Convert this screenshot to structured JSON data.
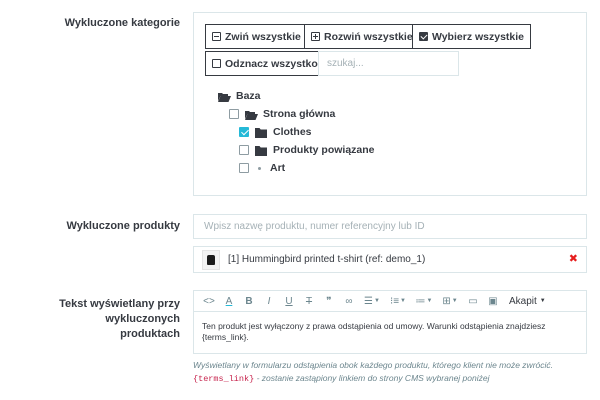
{
  "excluded_categories": {
    "label": "Wykluczone kategorie",
    "buttons": {
      "collapse_all": "Zwiń wszystkie",
      "expand_all": "Rozwiń wszystkie",
      "select_all": "Wybierz wszystkie",
      "unselect_all": "Odznacz wszystko"
    },
    "search_placeholder": "szukaj...",
    "tree": {
      "root": "Baza",
      "home": "Strona główna",
      "children": [
        {
          "label": "Clothes",
          "checked": true
        },
        {
          "label": "Produkty powiązane",
          "checked": false
        },
        {
          "label": "Art",
          "checked": false
        }
      ]
    }
  },
  "excluded_products": {
    "label": "Wykluczone produkty",
    "search_placeholder": "Wpisz nazwę produktu, numer referencyjny lub ID",
    "items": [
      {
        "text": "[1] Hummingbird printed t-shirt (ref: demo_1)"
      }
    ],
    "remove_icon": "✖"
  },
  "display_text": {
    "label_line1": "Tekst wyświetlany przy wykluczonych",
    "label_line2": "produktach",
    "toolbar": {
      "format_label": "Akapit"
    },
    "body": "Ten produkt jest wyłączony z prawa odstąpienia od umowy. Warunki odstąpienia znajdziesz {terms_link}.",
    "help_line1": "Wyświetlany w formularzu odstąpienia obok każdego produktu, którego klient nie może zwrócić.",
    "help_code": "{terms_link}",
    "help_line2_rest": " - zostanie zastąpiony linkiem do strony CMS wybranej poniżej"
  },
  "colors": {
    "accent": "#25b9d7",
    "danger": "#e61e1e",
    "border": "#dbe6e9",
    "text": "#363a41",
    "muted": "#6c868e",
    "code": "#c7254e"
  }
}
